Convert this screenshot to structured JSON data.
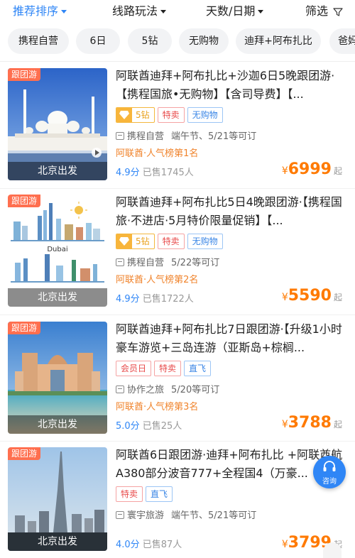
{
  "sortbar": {
    "items": [
      {
        "label": "推荐排序",
        "active": true
      },
      {
        "label": "线路玩法",
        "active": false
      },
      {
        "label": "天数/日期",
        "active": false
      },
      {
        "label": "筛选",
        "active": false
      }
    ],
    "accent": "#2f86f6"
  },
  "quick_tags": [
    "携程自营",
    "6日",
    "5钻",
    "无购物",
    "迪拜+阿布扎比",
    "爸妈"
  ],
  "products": [
    {
      "badge": "跟团游",
      "depart": "北京出发",
      "title": "阿联酋迪拜+阿布扎比+沙迦6日5晚跟团游·【携程国旅•无购物】【含司导费】【...",
      "tags": [
        {
          "label": "5钻",
          "style": "diamond"
        },
        {
          "label": "特卖",
          "style": "red"
        },
        {
          "label": "无购物",
          "style": "blue"
        }
      ],
      "supplier": "携程自营",
      "date_note": "端午节、5/21等可订",
      "rank": "阿联酋·人气榜第1名",
      "score": "4.9分",
      "sold": "已售1745人",
      "currency": "¥",
      "price": "6999",
      "price_suffix": "起"
    },
    {
      "badge": "跟团游",
      "depart": "北京出发",
      "title": "阿联酋迪拜+阿布扎比5日4晚跟团游·【携程国旅·不进店·5月特价限量促销】【...",
      "tags": [
        {
          "label": "5钻",
          "style": "diamond"
        },
        {
          "label": "特卖",
          "style": "red"
        },
        {
          "label": "无购物",
          "style": "blue"
        }
      ],
      "supplier": "携程自营",
      "date_note": "5/22等可订",
      "rank": "阿联酋·人气榜第2名",
      "score": "4.9分",
      "sold": "已售1722人",
      "currency": "¥",
      "price": "5590",
      "price_suffix": "起",
      "image_text": "Dubai"
    },
    {
      "badge": "跟团游",
      "depart": "北京出发",
      "title": "阿联酋迪拜+阿布扎比7日跟团游·【升级1小时豪车游览+三岛连游（亚斯岛+棕榈...",
      "tags": [
        {
          "label": "会员日",
          "style": "red"
        },
        {
          "label": "特卖",
          "style": "red"
        },
        {
          "label": "直飞",
          "style": "blue"
        }
      ],
      "supplier": "协作之旅",
      "date_note": "5/20等可订",
      "rank": "阿联酋·人气榜第3名",
      "score": "5.0分",
      "sold": "已售25人",
      "currency": "¥",
      "price": "3788",
      "price_suffix": "起"
    },
    {
      "badge": "跟团游",
      "depart": "北京出发",
      "title": "阿联酋6日跟团游·迪拜+阿布扎比 +阿联酋航A380部分波音777+全程国4（万豪...",
      "tags": [
        {
          "label": "特卖",
          "style": "red"
        },
        {
          "label": "直飞",
          "style": "blue"
        }
      ],
      "supplier": "寰宇旅游",
      "date_note": "端午节、5/21等可订",
      "rank": "",
      "score": "4.0分",
      "sold": "已售87人",
      "currency": "¥",
      "price": "3799",
      "price_suffix": "起"
    }
  ],
  "consult": {
    "label": "咨询"
  },
  "colors": {
    "price": "#ff7a00",
    "rank": "#f0832b",
    "badge": "#ff6f4f",
    "score": "#2f86f6"
  },
  "icons": [
    "chevron-down-icon",
    "filter-funnel-icon",
    "diamond-icon",
    "supplier-icon",
    "headset-icon",
    "play-icon"
  ]
}
